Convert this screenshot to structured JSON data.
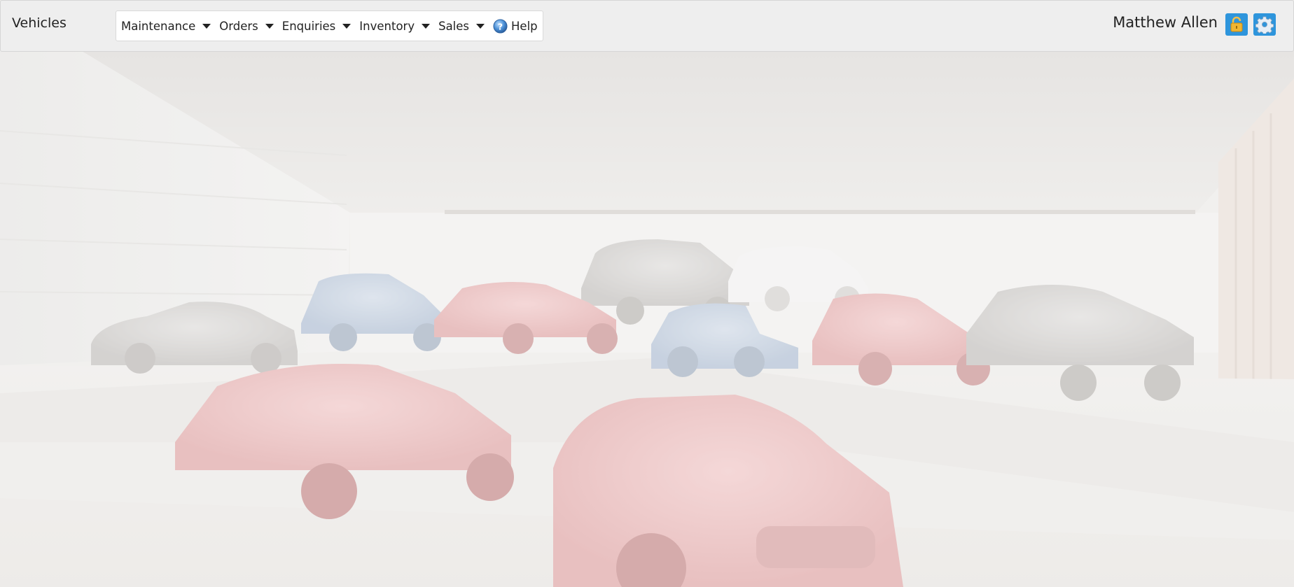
{
  "header": {
    "title": "Vehicles",
    "user_name": "Matthew Allen"
  },
  "menu": {
    "items": [
      {
        "label": "Maintenance",
        "icon": "caret-down-icon"
      },
      {
        "label": "Orders",
        "icon": "caret-down-icon"
      },
      {
        "label": "Enquiries",
        "icon": "caret-down-icon"
      },
      {
        "label": "Inventory",
        "icon": "caret-down-icon"
      },
      {
        "label": "Sales",
        "icon": "caret-down-icon"
      }
    ],
    "help": {
      "label": "Help",
      "icon": "help-icon"
    }
  },
  "actions": {
    "lock": {
      "icon": "padlock-icon"
    },
    "settings": {
      "icon": "gear-icon"
    }
  },
  "colors": {
    "accent": "#2e95dc",
    "topbar_bg": "#eeeeee",
    "car_red": "#e7b3b3",
    "car_blue": "#b7c5d8",
    "car_silver": "#cfcdcb",
    "car_white": "#e9e9e9"
  }
}
